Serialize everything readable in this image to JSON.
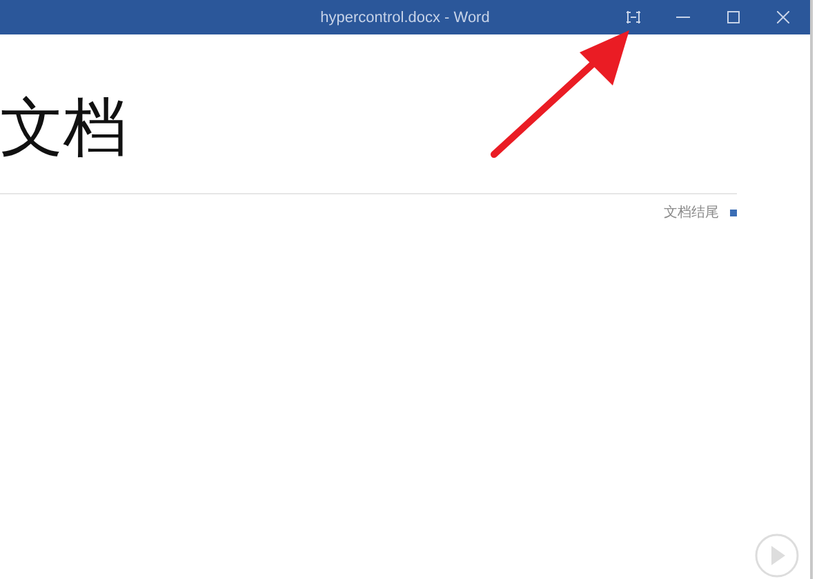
{
  "window": {
    "title": "hypercontrol.docx - Word"
  },
  "document": {
    "heading": "文档",
    "end_label": "文档结尾"
  }
}
